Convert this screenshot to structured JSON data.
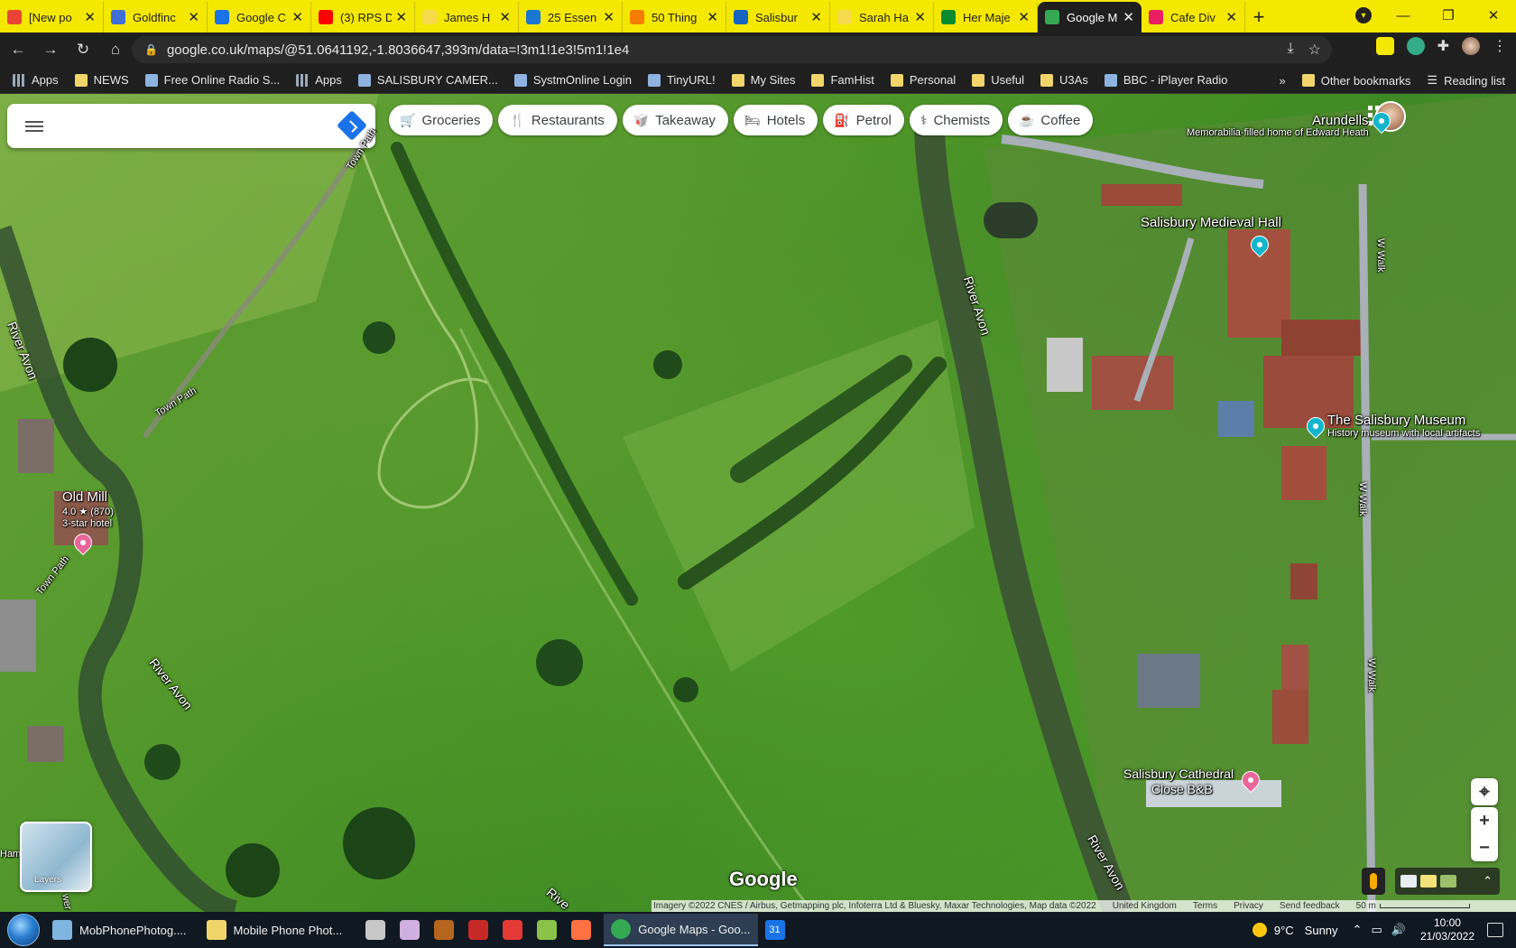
{
  "browser": {
    "tabs": [
      {
        "title": "[New po",
        "color": "#ea4335"
      },
      {
        "title": "Goldfinc",
        "color": "#3d6fd6"
      },
      {
        "title": "Google C",
        "color": "#1a73e8"
      },
      {
        "title": "(3) RPS D",
        "color": "#ff0000"
      },
      {
        "title": "James H",
        "color": "#f6d94c"
      },
      {
        "title": "25 Essen",
        "color": "#1976d2"
      },
      {
        "title": "50 Thing",
        "color": "#f57c00"
      },
      {
        "title": "Salisbur",
        "color": "#1565c0"
      },
      {
        "title": "Sarah Ha",
        "color": "#f6d94c"
      },
      {
        "title": "Her Maje",
        "color": "#0b8a2f"
      },
      {
        "title": "Google M",
        "color": "#34a853",
        "active": true
      },
      {
        "title": "Cafe Div",
        "color": "#e91e63"
      }
    ],
    "url": "google.co.uk/maps/@51.0641192,-1.8036647,393m/data=!3m1!1e3!5m1!1e4",
    "bookmarks": [
      {
        "label": "Apps",
        "type": "apps"
      },
      {
        "label": "NEWS",
        "type": "folder"
      },
      {
        "label": "Free Online Radio S...",
        "type": "site"
      },
      {
        "label": "Apps",
        "type": "apps"
      },
      {
        "label": "SALISBURY CAMER...",
        "type": "site"
      },
      {
        "label": "SystmOnline Login",
        "type": "site"
      },
      {
        "label": "TinyURL!",
        "type": "site"
      },
      {
        "label": "My Sites",
        "type": "folder"
      },
      {
        "label": "FamHist",
        "type": "folder"
      },
      {
        "label": "Personal",
        "type": "folder"
      },
      {
        "label": "Useful",
        "type": "folder"
      },
      {
        "label": "U3As",
        "type": "folder"
      },
      {
        "label": "BBC - iPlayer Radio",
        "type": "site"
      }
    ],
    "bookmarks_right": {
      "more": "»",
      "other": "Other bookmarks",
      "reading": "Reading list"
    }
  },
  "map": {
    "search_placeholder": "",
    "chips": [
      {
        "label": "Groceries",
        "icon": "🛒"
      },
      {
        "label": "Restaurants",
        "icon": "🍴"
      },
      {
        "label": "Takeaway",
        "icon": "🥡"
      },
      {
        "label": "Hotels",
        "icon": "🛏"
      },
      {
        "label": "Petrol",
        "icon": "⛽"
      },
      {
        "label": "Chemists",
        "icon": "⚕"
      },
      {
        "label": "Coffee",
        "icon": "☕"
      }
    ],
    "places": {
      "arundells": {
        "name": "Arundells",
        "desc": "Memorabilia-filled home of Edward Heath"
      },
      "medieval_hall": {
        "name": "Salisbury Medieval Hall"
      },
      "museum": {
        "name": "The Salisbury Museum",
        "desc": "History museum with local artifacts"
      },
      "old_mill": {
        "name": "Old Mill",
        "rating": "4.0 ★ (870)",
        "desc": "3-star hotel"
      },
      "bnb": {
        "name_line1": "Salisbury Cathedral",
        "name_line2": "Close B&B"
      }
    },
    "roads": {
      "town_path_1": "Town Path",
      "town_path_2": "Town Path",
      "town_path_3": "Town Path",
      "river_avon_1": "River Avon",
      "river_avon_2": "River Avon",
      "river_avon_3": "River Avon",
      "river_avon_4": "River Avon",
      "river_partial": "Rive",
      "w_walk_1": "W Walk",
      "w_walk_2": "W Walk",
      "w_walk_3": "W Walk",
      "ham_partial": "Ham",
      "partial_wer": "wer"
    },
    "layers_label": "Layers",
    "logo": "Google",
    "attribution": [
      "Imagery ©2022 CNES / Airbus, Getmapping plc, Infoterra Ltd & Bluesky, Maxar Technologies, Map data ©2022",
      "United Kingdom",
      "Terms",
      "Privacy",
      "Send feedback"
    ],
    "scale": "50 m",
    "zoom_in": "+",
    "zoom_out": "−"
  },
  "taskbar": {
    "items": [
      {
        "label": "MobPhonePhotog....",
        "color": "#7fb6e0"
      },
      {
        "label": "Mobile Phone Phot...",
        "color": "#f1d56b"
      }
    ],
    "icons": [
      {
        "name": "recycle",
        "color": "#c8c8c8"
      },
      {
        "name": "paint",
        "color": "#d0b0e0"
      },
      {
        "name": "bridge",
        "color": "#b5651d"
      },
      {
        "name": "red-diamond",
        "color": "#c62828"
      },
      {
        "name": "opera",
        "color": "#e53935"
      },
      {
        "name": "picasa",
        "color": "#8bc34a"
      },
      {
        "name": "eye",
        "color": "#ff7043"
      }
    ],
    "active_item": {
      "label": "Google Maps - Goo...",
      "color": "#34a853"
    },
    "calendar": "31",
    "weather": {
      "temp": "9°C",
      "condition": "Sunny"
    },
    "time": "10:00",
    "date": "21/03/2022"
  }
}
